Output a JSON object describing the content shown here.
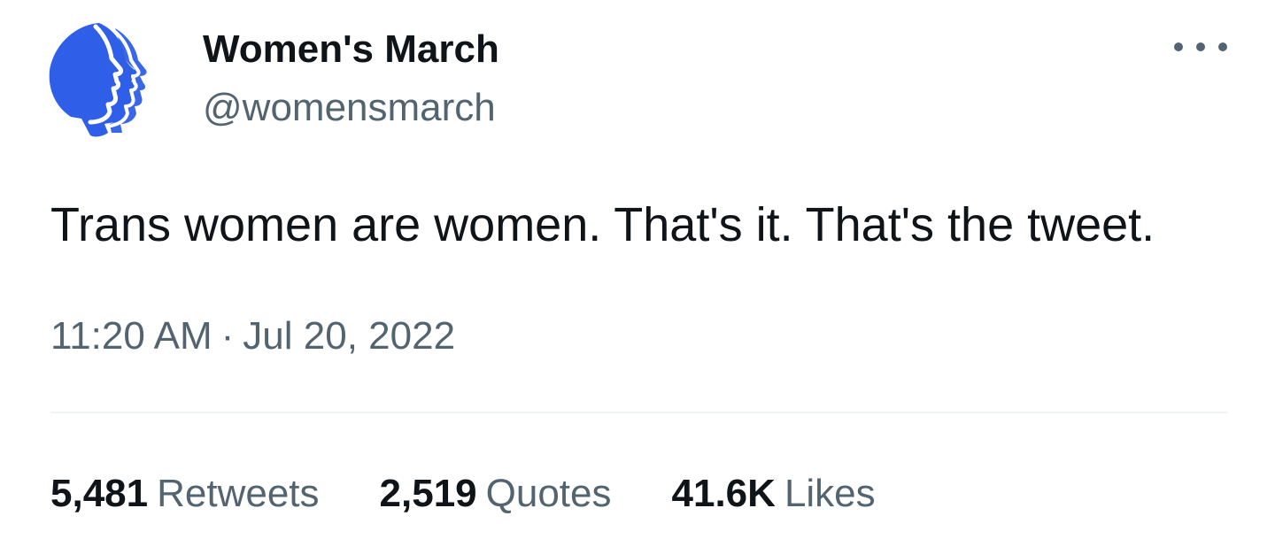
{
  "author": {
    "display_name": "Women's March",
    "handle": "@womensmarch",
    "logo_color": "#2f5ee8"
  },
  "tweet": {
    "text": "Trans women are women. That's it. That's the tweet.",
    "time": "11:20 AM",
    "separator": "·",
    "date": "Jul 20, 2022"
  },
  "stats": {
    "retweets": {
      "count": "5,481",
      "label": "Retweets"
    },
    "quotes": {
      "count": "2,519",
      "label": "Quotes"
    },
    "likes": {
      "count": "41.6K",
      "label": "Likes"
    }
  },
  "icons": {
    "avatar": "womens-march-logo",
    "more": "more-options-icon"
  }
}
